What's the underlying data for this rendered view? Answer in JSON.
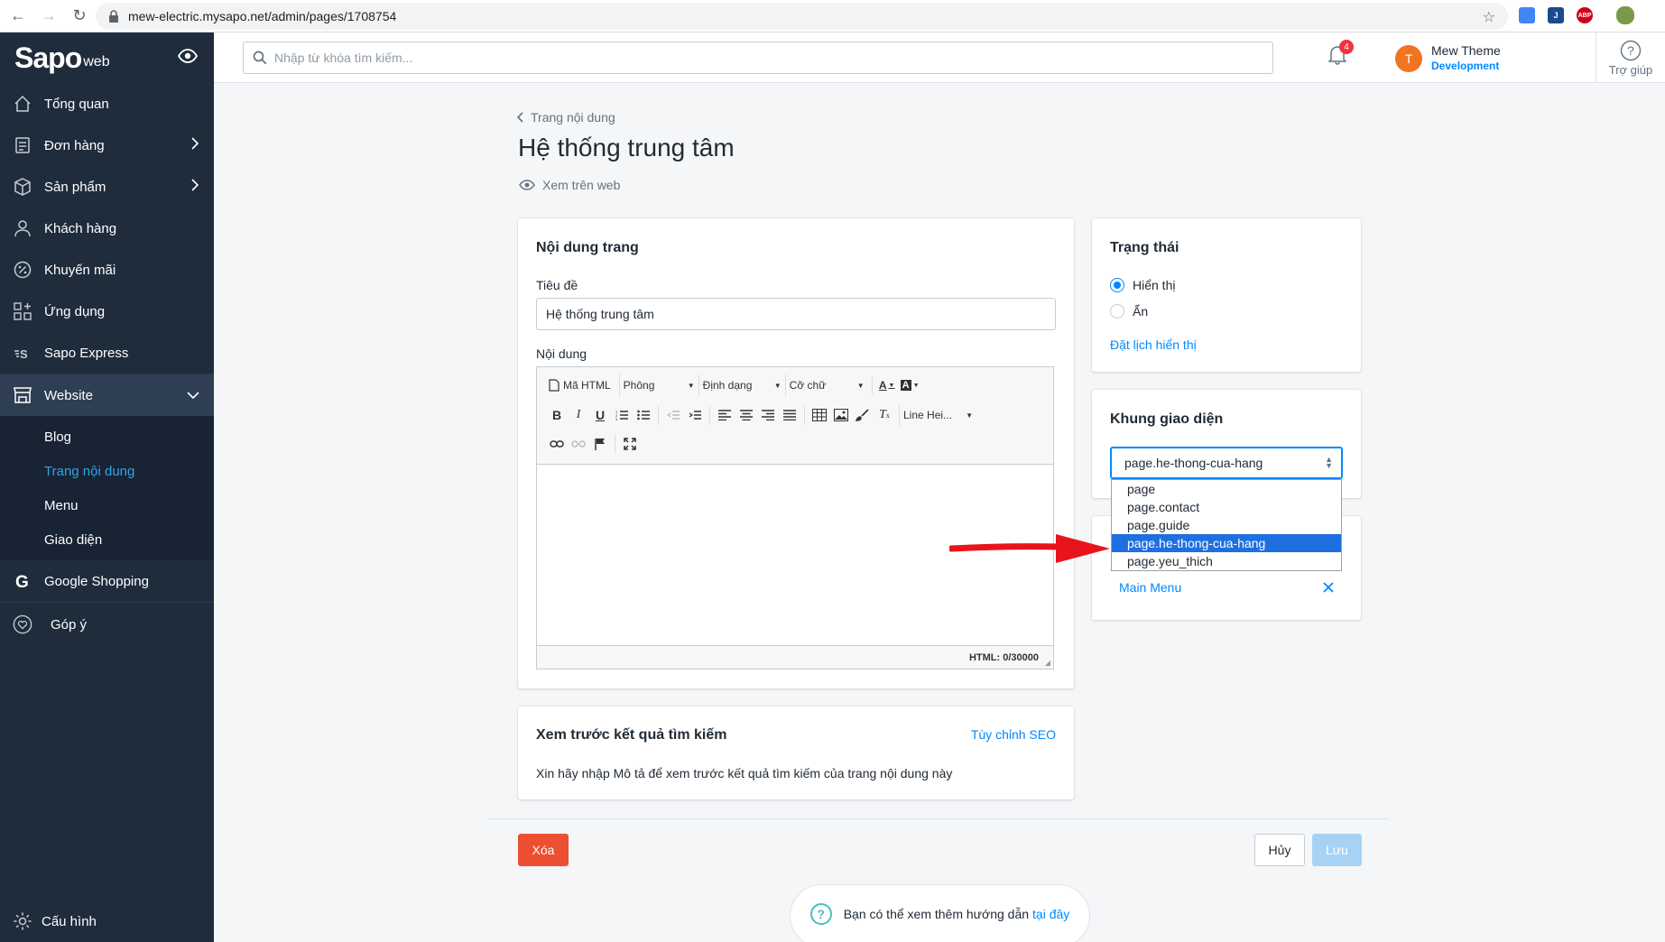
{
  "browser": {
    "url": "mew-electric.mysapo.net/admin/pages/1708754",
    "extensions": [
      "ABP"
    ]
  },
  "brand": {
    "logo_main": "Sapo",
    "logo_sub": "web"
  },
  "sidebar": {
    "items": [
      {
        "label": "Tổng quan",
        "icon": "home-icon"
      },
      {
        "label": "Đơn hàng",
        "icon": "orders-icon"
      },
      {
        "label": "Sản phẩm",
        "icon": "box-icon"
      },
      {
        "label": "Khách hàng",
        "icon": "user-icon"
      },
      {
        "label": "Khuyến mãi",
        "icon": "percent-icon"
      },
      {
        "label": "Ứng dụng",
        "icon": "apps-icon"
      },
      {
        "label": "Sapo Express",
        "icon": "express-icon"
      },
      {
        "label": "Website",
        "icon": "store-icon"
      }
    ],
    "website_sub": [
      "Blog",
      "Trang nội dung",
      "Menu",
      "Giao diện"
    ],
    "google_shopping": "Google Shopping",
    "feedback": "Góp ý",
    "config": "Cấu hình"
  },
  "header": {
    "search_placeholder": "Nhập từ khóa tìm kiếm...",
    "notification_count": "4",
    "avatar_letter": "T",
    "user_name": "Mew Theme",
    "user_role": "Development",
    "help": "Trợ giúp"
  },
  "page": {
    "breadcrumb": "Trang nội dung",
    "title": "Hệ thống trung tâm",
    "view_web": "Xem trên web"
  },
  "content_card": {
    "heading": "Nội dung trang",
    "title_label": "Tiêu đề",
    "title_value": "Hệ thống trung tâm",
    "content_label": "Nội dung",
    "toolbar": {
      "html_btn": "Mã HTML",
      "font": "Phông",
      "format": "Định dạng",
      "size": "Cỡ chữ",
      "line_height": "Line Hei..."
    },
    "html_counter": "HTML: 0/30000"
  },
  "seo_card": {
    "heading": "Xem trước kết quả tìm kiếm",
    "customize": "Tùy chỉnh SEO",
    "hint": "Xin hãy nhập Mô tả để xem trước kết quả tìm kiếm của trang nội dung này"
  },
  "status_card": {
    "heading": "Trạng thái",
    "visible": "Hiển thị",
    "hidden": "Ẩn",
    "schedule": "Đặt lịch hiển thị"
  },
  "template_card": {
    "heading": "Khung giao diện",
    "selected": "page.he-thong-cua-hang",
    "options": [
      "page",
      "page.contact",
      "page.guide",
      "page.he-thong-cua-hang",
      "page.yeu_thich"
    ]
  },
  "menu_card": {
    "menu_link": "Main Menu"
  },
  "actions": {
    "delete": "Xóa",
    "cancel": "Hủy",
    "save": "Lưu"
  },
  "guide": {
    "text": "Bạn có thể xem thêm hướng dẫn",
    "link": "tại đây"
  },
  "colors": {
    "sidebar": "#1f2c3c",
    "accent": "#0088ff",
    "danger": "#ed4f32",
    "arrow": "#e8141c"
  }
}
